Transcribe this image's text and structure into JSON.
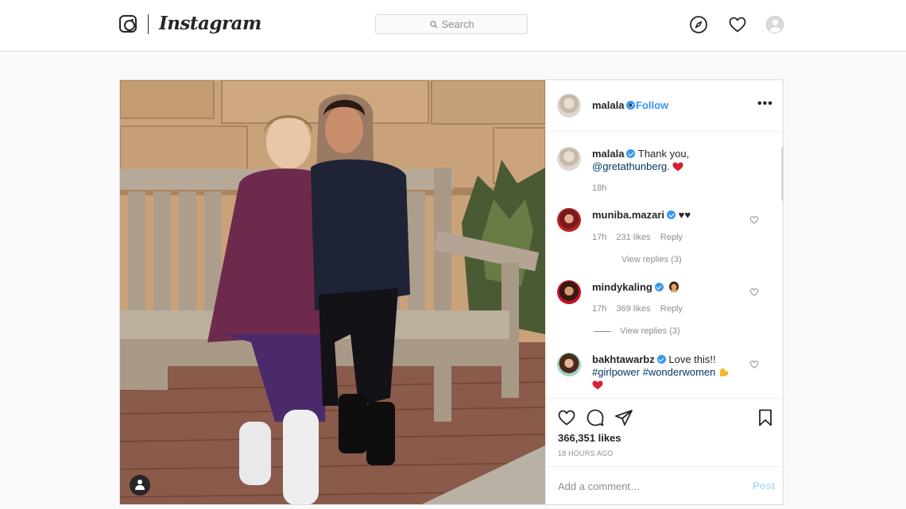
{
  "brand": {
    "wordmark": "Instagram"
  },
  "nav": {
    "search_placeholder": "Search",
    "icons": [
      "instagram-glyph-icon",
      "compass-icon",
      "heart-icon",
      "profile-avatar"
    ]
  },
  "post": {
    "author": {
      "username": "malala",
      "verified": true,
      "follow_label": "Follow",
      "separator": "•"
    },
    "more_label": "•••",
    "caption": {
      "username": "malala",
      "text_before": "Thank you,",
      "mention": "@gretathunberg.",
      "emoji": "red-heart",
      "time": "18h"
    },
    "comments": [
      {
        "username": "muniba.mazari",
        "verified": true,
        "text": "♥♥",
        "time": "17h",
        "likes": "231 likes",
        "reply_label": "Reply",
        "view_replies": "View replies (3)"
      },
      {
        "username": "mindykaling",
        "verified": true,
        "text": "",
        "emoji": "woman-emoji",
        "time": "17h",
        "likes": "369 likes",
        "reply_label": "Reply",
        "view_replies": "View replies (3)"
      },
      {
        "username": "bakhtawarbz",
        "verified": true,
        "text": "Love this!!",
        "hashtags": "#girlpower #wonderwomen",
        "emoji": "flexed-biceps",
        "emoji2": "red-heart"
      }
    ],
    "likes_count": "366,351 likes",
    "posted_ago": "18 HOURS AGO",
    "comment_placeholder": "Add a comment…",
    "post_button": "Post"
  },
  "colors": {
    "link": "#3897f0",
    "verified": "#3897f0",
    "heart": "#ed4956",
    "muted": "#8e8e8e"
  }
}
